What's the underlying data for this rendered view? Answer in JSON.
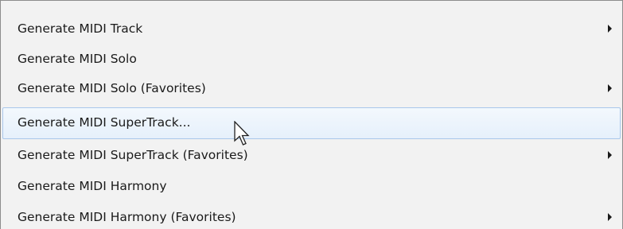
{
  "menu": {
    "items": [
      {
        "label": "Generate MIDI Track",
        "has_submenu": true,
        "hovered": false
      },
      {
        "label": "Generate MIDI Solo",
        "has_submenu": false,
        "hovered": false
      },
      {
        "label": "Generate MIDI Solo (Favorites)",
        "has_submenu": true,
        "hovered": false
      },
      {
        "label": "Generate MIDI SuperTrack...",
        "has_submenu": false,
        "hovered": true
      },
      {
        "label": "Generate MIDI SuperTrack (Favorites)",
        "has_submenu": true,
        "hovered": false
      },
      {
        "label": "Generate MIDI Harmony",
        "has_submenu": false,
        "hovered": false
      },
      {
        "label": "Generate MIDI Harmony (Favorites)",
        "has_submenu": true,
        "hovered": false
      }
    ]
  },
  "icons": {
    "submenu_arrow": "chevron-right-icon",
    "cursor": "arrow-pointer-icon"
  },
  "colors": {
    "menu_background": "#f2f2f2",
    "hover_border": "#a9c7eb",
    "hover_fill": "#e6f0fb",
    "text": "#1a1a1a"
  }
}
